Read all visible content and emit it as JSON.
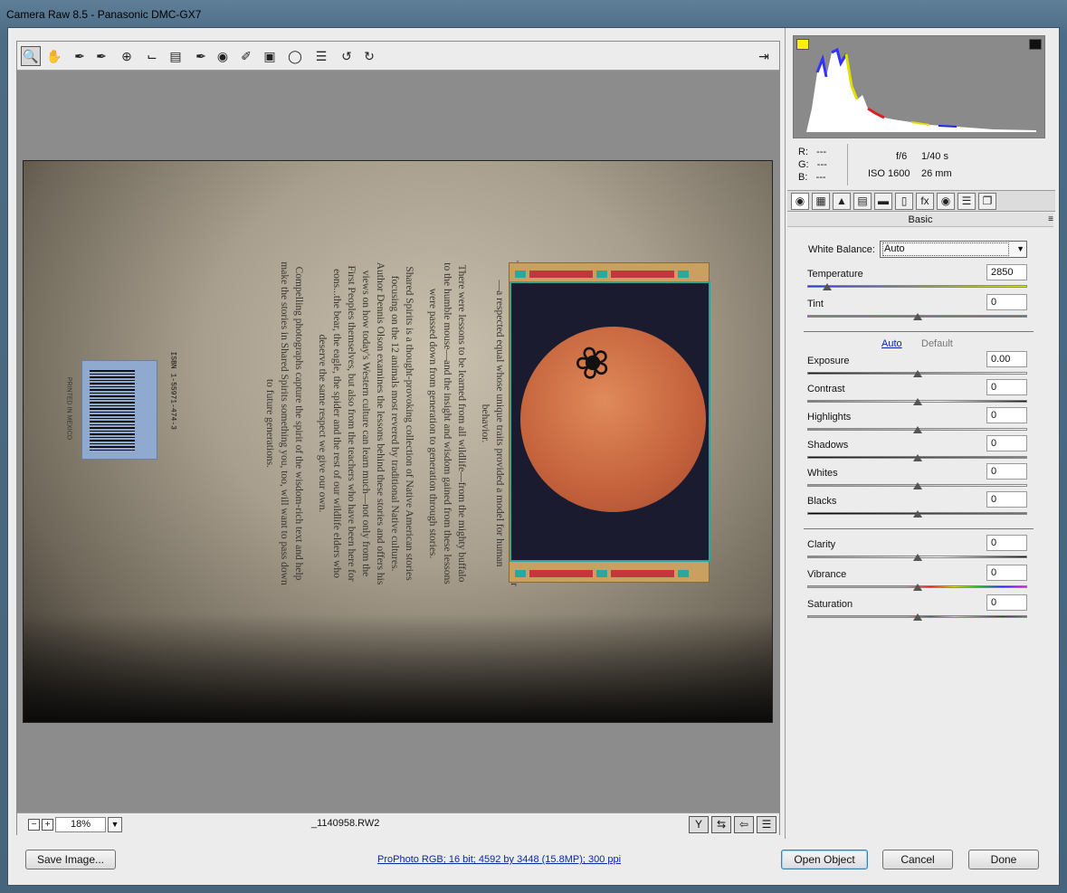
{
  "window": {
    "title": "Camera Raw 8.5  -  Panasonic DMC-GX7"
  },
  "toolbar": {
    "tools": [
      "zoom-tool",
      "hand-tool",
      "white-balance-tool",
      "color-sampler-tool",
      "targeted-adjustment-tool",
      "crop-tool",
      "straighten-tool",
      "spot-removal-tool",
      "red-eye-removal-tool",
      "adjustment-brush-tool",
      "graduated-filter-tool",
      "radial-filter-tool",
      "preferences-tool",
      "rotate-ccw-tool",
      "rotate-cw-tool"
    ],
    "fullscreen_icon": "toggle-fullscreen-icon"
  },
  "photo": {
    "back_cover_text": [
      "To Native Americans, every stone, every plant and every animal was a teacher—a respected equal whose unique traits provided a model for human behavior.",
      "There were lessons to be learned from all wildlife—from the mighty buffalo to the humble mouse—and the insight and wisdom gained from these lessons were passed down from generation to generation through stories.",
      "Shared Spirits is a thought-provoking collection of Native American stories focusing on the 12 animals most revered by traditional Native cultures. Author Dennis Olson examines the lessons behind these stories and offers his views on how today's Western culture can learn much—not only from the First Peoples themselves, but also from the teachers who have been here for eons...the bear, the eagle, the spider and the rest of our wildlife elders who deserve the same respect we give our own.",
      "Compelling photographs capture the spirit of the wisdom-rich text and help make the stories in Shared Spirits something you, too, will want to pass down to future generations."
    ],
    "isbn": "ISBN 1-55971-474-3",
    "printed": "PRINTED IN MEXICO"
  },
  "statusbar": {
    "zoom_value": "18%",
    "filename": "_1140958.RW2"
  },
  "histogram": {
    "r_label": "R:",
    "r_value": "---",
    "g_label": "G:",
    "g_value": "---",
    "b_label": "B:",
    "b_value": "---",
    "aperture": "f/6",
    "shutter": "1/40 s",
    "iso": "ISO 1600",
    "focal": "26 mm"
  },
  "panel": {
    "tabs": [
      "basic-tab",
      "tone-curve-tab",
      "detail-tab",
      "hsl-tab",
      "split-toning-tab",
      "lens-corrections-tab",
      "effects-tab",
      "camera-calibration-tab",
      "presets-tab",
      "snapshots-tab"
    ],
    "section_title": "Basic",
    "white_balance_label": "White Balance:",
    "white_balance_value": "Auto",
    "auto_label": "Auto",
    "default_label": "Default",
    "sliders": {
      "temperature": {
        "label": "Temperature",
        "value": "2850",
        "fraction": 0.09
      },
      "tint": {
        "label": "Tint",
        "value": "0",
        "fraction": 0.5
      },
      "exposure": {
        "label": "Exposure",
        "value": "0.00",
        "fraction": 0.5
      },
      "contrast": {
        "label": "Contrast",
        "value": "0",
        "fraction": 0.5
      },
      "highlights": {
        "label": "Highlights",
        "value": "0",
        "fraction": 0.5
      },
      "shadows": {
        "label": "Shadows",
        "value": "0",
        "fraction": 0.5
      },
      "whites": {
        "label": "Whites",
        "value": "0",
        "fraction": 0.5
      },
      "blacks": {
        "label": "Blacks",
        "value": "0",
        "fraction": 0.5
      },
      "clarity": {
        "label": "Clarity",
        "value": "0",
        "fraction": 0.5
      },
      "vibrance": {
        "label": "Vibrance",
        "value": "0",
        "fraction": 0.5
      },
      "saturation": {
        "label": "Saturation",
        "value": "0",
        "fraction": 0.5
      }
    }
  },
  "footer": {
    "save_label": "Save Image...",
    "workflow_label": "ProPhoto RGB; 16 bit; 4592 by 3448 (15.8MP); 300 ppi",
    "open_label": "Open Object",
    "cancel_label": "Cancel",
    "done_label": "Done"
  },
  "colors": {
    "accent": "#0b28a8",
    "clip_shadow": "#ffef00",
    "clip_highlight": "#111111"
  }
}
